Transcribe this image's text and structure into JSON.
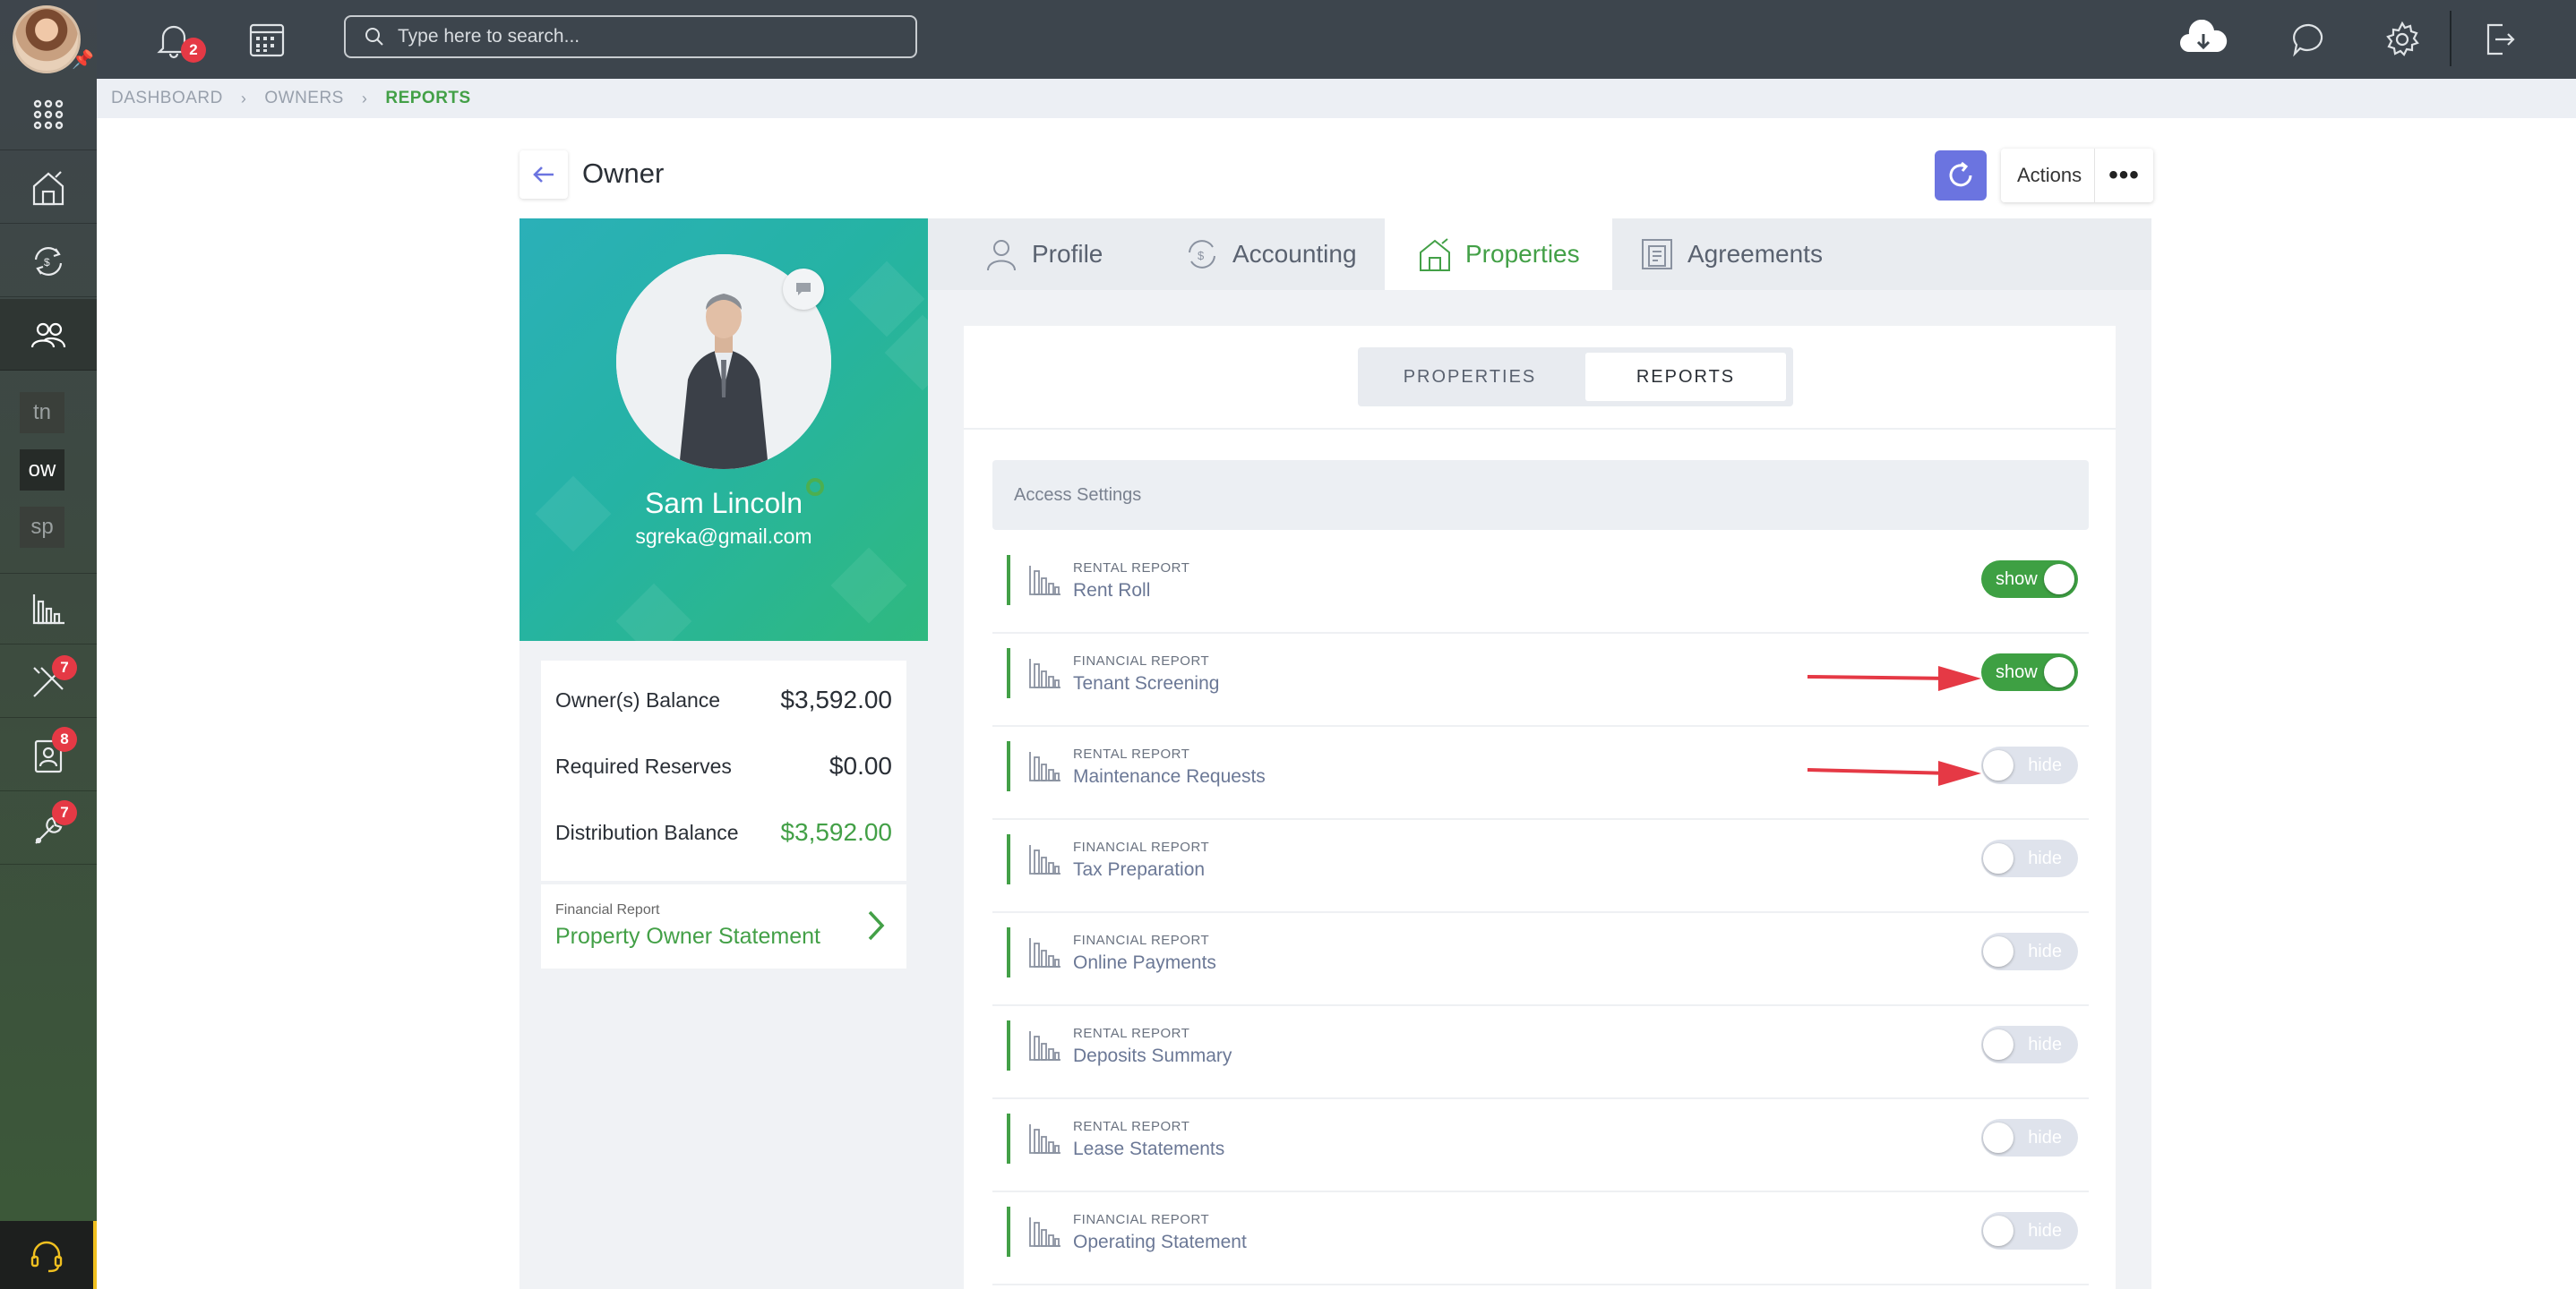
{
  "topbar": {
    "notification_count": "2",
    "search_placeholder": "Type here to search..."
  },
  "sidebar": {
    "letters": [
      "tn",
      "ow",
      "sp"
    ],
    "badges": {
      "tools": "7",
      "contacts": "8",
      "maintenance": "7"
    }
  },
  "breadcrumb": [
    "DASHBOARD",
    "OWNERS",
    "REPORTS"
  ],
  "page": {
    "title": "Owner",
    "actions_label": "Actions",
    "more_label": "•••"
  },
  "owner": {
    "name": "Sam Lincoln",
    "email": "sgreka@gmail.com"
  },
  "balances": [
    {
      "label": "Owner(s) Balance",
      "value": "$3,592.00",
      "highlight": false
    },
    {
      "label": "Required Reserves",
      "value": "$0.00",
      "highlight": false
    },
    {
      "label": "Distribution Balance",
      "value": "$3,592.00",
      "highlight": true
    }
  ],
  "statement": {
    "type": "Financial Report",
    "title": "Property Owner Statement"
  },
  "tabs": [
    "Profile",
    "Accounting",
    "Properties",
    "Agreements"
  ],
  "active_tab": "Properties",
  "subtabs": [
    "PROPERTIES",
    "REPORTS"
  ],
  "active_subtab": "REPORTS",
  "access_settings_label": "Access Settings",
  "reports": [
    {
      "type": "RENTAL REPORT",
      "name": "Rent Roll",
      "state": "show"
    },
    {
      "type": "FINANCIAL REPORT",
      "name": "Tenant Screening",
      "state": "show"
    },
    {
      "type": "RENTAL REPORT",
      "name": "Maintenance Requests",
      "state": "hide"
    },
    {
      "type": "FINANCIAL REPORT",
      "name": "Tax Preparation",
      "state": "hide"
    },
    {
      "type": "FINANCIAL REPORT",
      "name": "Online Payments",
      "state": "hide"
    },
    {
      "type": "RENTAL REPORT",
      "name": "Deposits Summary",
      "state": "hide"
    },
    {
      "type": "RENTAL REPORT",
      "name": "Lease Statements",
      "state": "hide"
    },
    {
      "type": "FINANCIAL REPORT",
      "name": "Operating Statement",
      "state": "hide"
    }
  ],
  "colors": {
    "accent_green": "#43a047",
    "refresh_blue": "#6b74e0",
    "arrow_red": "#e53945"
  }
}
